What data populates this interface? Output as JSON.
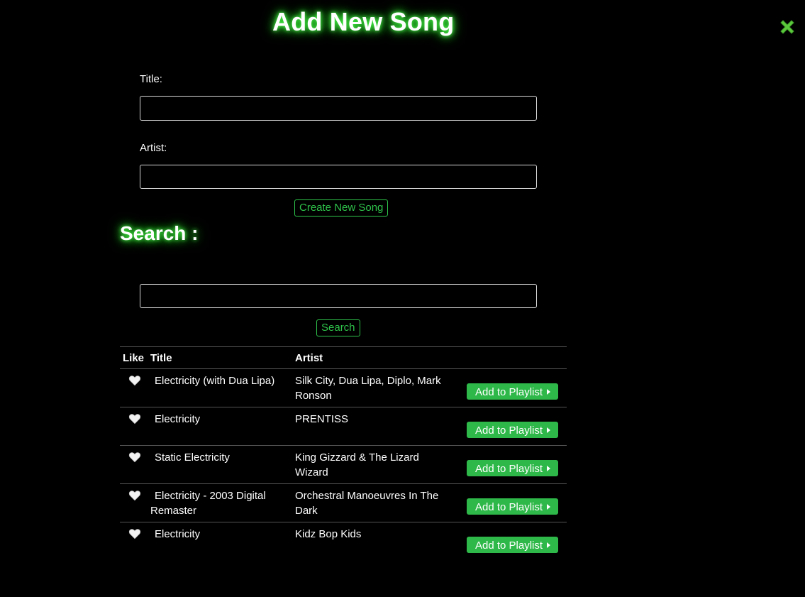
{
  "header": {
    "title": "Add New Song"
  },
  "form": {
    "title_label": "Title:",
    "title_value": "",
    "artist_label": "Artist:",
    "artist_value": "",
    "create_button": "Create New Song"
  },
  "search": {
    "heading": "Search :",
    "value": "",
    "button": "Search"
  },
  "table": {
    "headers": {
      "like": "Like",
      "title": "Title",
      "artist": "Artist"
    },
    "add_button_label": "Add to Playlist",
    "rows": [
      {
        "title": "Electricity (with Dua Lipa)",
        "artist": "Silk City, Dua Lipa, Diplo, Mark Ronson",
        "liked": false
      },
      {
        "title": "Electricity",
        "artist": "PRENTISS",
        "liked": false
      },
      {
        "title": "Static Electricity",
        "artist": "King Gizzard & The Lizard Wizard",
        "liked": false
      },
      {
        "title": "Electricity - 2003 Digital Remaster",
        "artist": "Orchestral Manoeuvres In The Dark",
        "liked": false
      },
      {
        "title": "Electricity",
        "artist": "Kidz Bop Kids",
        "liked": false
      }
    ]
  },
  "icons": {
    "close": "close-icon",
    "heart": "heart-outline-icon",
    "caret": "caret-right-icon"
  },
  "colors": {
    "background": "#000000",
    "accent_green": "#2fb84a",
    "glow_green": "#4cff4c",
    "close_green": "#5cc93c"
  }
}
